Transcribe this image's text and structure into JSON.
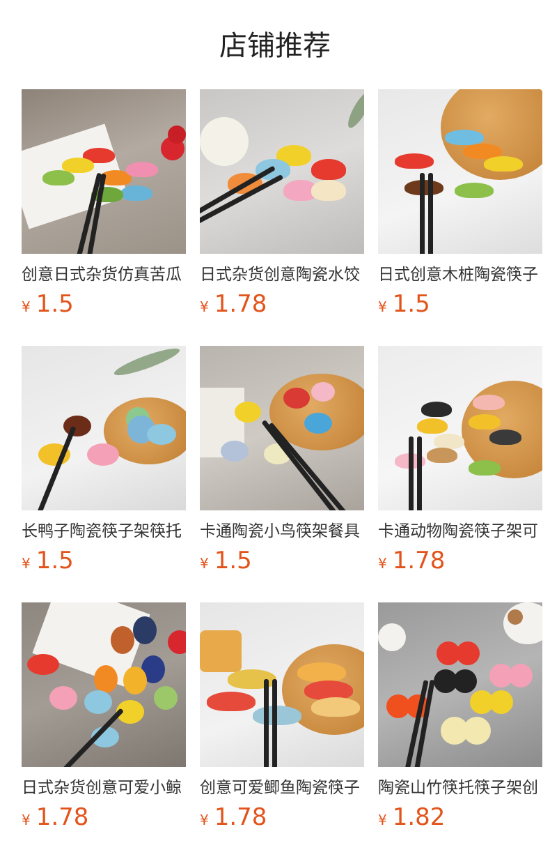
{
  "page_title": "店铺推荐",
  "currency": "¥",
  "accent_color": "#e2541b",
  "products": [
    {
      "name": "创意日式杂货仿真苦瓜",
      "price": "1.5",
      "scene": "peas"
    },
    {
      "name": "日式杂货创意陶瓷水饺",
      "price": "1.78",
      "scene": "dumpling"
    },
    {
      "name": "日式创意木桩陶瓷筷子",
      "price": "1.5",
      "scene": "log"
    },
    {
      "name": "长鸭子陶瓷筷子架筷托",
      "price": "1.5",
      "scene": "duck"
    },
    {
      "name": "卡通陶瓷小鸟筷架餐具",
      "price": "1.5",
      "scene": "bird"
    },
    {
      "name": "卡通动物陶瓷筷子架可",
      "price": "1.78",
      "scene": "animal"
    },
    {
      "name": "日式杂货创意可爱小鲸",
      "price": "1.78",
      "scene": "whale"
    },
    {
      "name": "创意可爱鲫鱼陶瓷筷子",
      "price": "1.78",
      "scene": "fish"
    },
    {
      "name": "陶瓷山竹筷托筷子架创",
      "price": "1.82",
      "scene": "gourd"
    }
  ]
}
